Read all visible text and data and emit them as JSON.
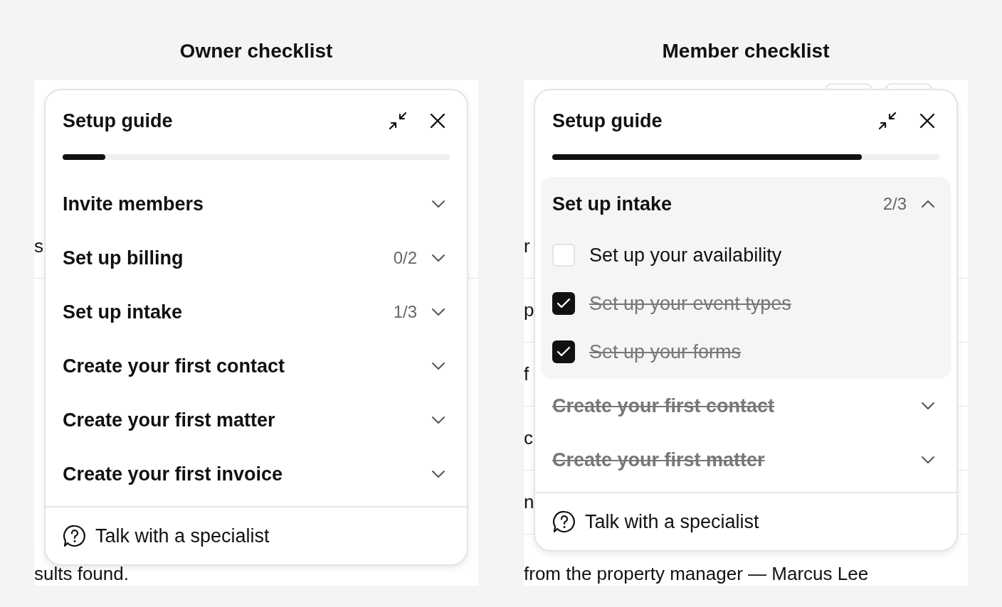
{
  "panels": [
    {
      "title": "Owner checklist",
      "background": {
        "rows": [
          "s"
        ],
        "bottom_text": "sults found."
      },
      "guide": {
        "title": "Setup guide",
        "level": 0.11,
        "footer": "Talk with a specialist",
        "items": [
          {
            "title": "Invite members",
            "done": false,
            "expanded": false
          },
          {
            "title": "Set up billing",
            "count": "0/2",
            "done": false,
            "expanded": false
          },
          {
            "title": "Set up intake",
            "count": "1/3",
            "done": false,
            "expanded": false
          },
          {
            "title": "Create your first contact",
            "done": false,
            "expanded": false
          },
          {
            "title": "Create your first matter",
            "done": false,
            "expanded": false
          },
          {
            "title": "Create your first invoice",
            "done": false,
            "expanded": false
          }
        ]
      }
    },
    {
      "title": "Member checklist",
      "background": {
        "rows": [
          "r",
          "p",
          "f",
          "c",
          "n"
        ],
        "bottom_text": "from the property manager — Marcus Lee",
        "toolbar": true
      },
      "guide": {
        "title": "Setup guide",
        "level": 0.8,
        "footer": "Talk with a specialist",
        "items": [
          {
            "title": "Set up intake",
            "count": "2/3",
            "done": false,
            "expanded": true,
            "tasks": [
              {
                "label": "Set up your availability",
                "checked": false
              },
              {
                "label": "Set up your event types",
                "checked": true
              },
              {
                "label": "Set up your forms",
                "checked": true
              }
            ]
          },
          {
            "title": "Create your first contact",
            "done": true,
            "expanded": false
          },
          {
            "title": "Create your first matter",
            "done": true,
            "expanded": false
          }
        ]
      }
    }
  ]
}
